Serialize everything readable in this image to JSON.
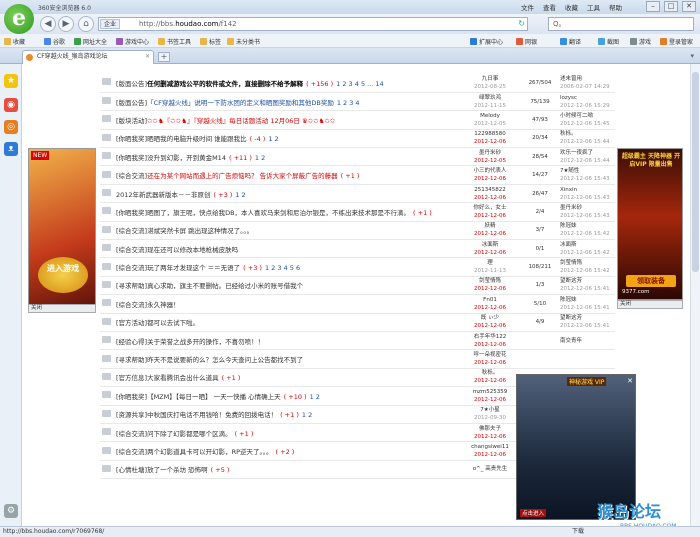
{
  "window": {
    "title": "360安全浏览器 6.0",
    "menu": [
      "文件",
      "查看",
      "收藏",
      "工具",
      "帮助"
    ]
  },
  "nav": {
    "mode": "企业",
    "url_prefix": "http://bbs.",
    "url_domain": "houdao.com",
    "url_path": "/f142",
    "search_placeholder": "Q。"
  },
  "favorites": [
    "收藏",
    "谷歌",
    "网址大全",
    "游戏中心",
    "书签工具",
    "标签",
    "未分类书"
  ],
  "toolbar_right": [
    "扩展中心",
    "网银",
    "翻译",
    "截图",
    "游戏",
    "登录管家"
  ],
  "tab": {
    "title": "CF穿越火线_猴岛游戏论坛"
  },
  "posts": [
    {
      "tag": "[版面公告]",
      "title": "任何删减游戏公平的软件或文件，直接删除不给予解释",
      "style": "bold",
      "pts": "( +156 )",
      "pages": "1 2 3 4 5 ... 14",
      "author": "九日事",
      "adate": "2012-08-25",
      "adred": false,
      "replies": "267/504",
      "last": "述未曾用",
      "ldate": "2006-02-07 14:29"
    },
    {
      "tag": "[版面公告]",
      "title": "「CF穿越火线」说明一下防水团的定义和晒图奖励和其他DB奖励",
      "style": "blue",
      "pts": "",
      "pages": "1 2 3 4",
      "author": "绿翠玖鸿",
      "adate": "2012-11-15",
      "adred": false,
      "replies": "75/139",
      "last": "lozysc",
      "ldate": "2012-12-06 15:29"
    },
    {
      "tag": "[版块活动]",
      "title": "✩✩♞『✩✩♞』『穿越火线』每日话题活动 12月06日 ♛✩✩♞✩✩",
      "style": "red",
      "pts": "",
      "pages": "",
      "author": "Melody",
      "adate": "2012-12-05",
      "adred": false,
      "replies": "47/93",
      "last": "小时候可二呦",
      "ldate": "2012-12-06 15:45"
    },
    {
      "tag": "[你晒我奖]",
      "title": "晒晒我的电脑升级时间   谁能跟我比",
      "style": "normal",
      "pts": "( -4 )",
      "pages": "1 2",
      "author": "122988580",
      "adate": "2012-12-06",
      "adred": true,
      "replies": "20/34",
      "last": "秋栎。",
      "ldate": "2012-12-06 15:44"
    },
    {
      "tag": "[你晒我奖]",
      "title": "没升到幻影，开到黄金M14",
      "style": "normal",
      "pts": "( +11 )",
      "pages": "1 2",
      "author": "墨丹米砂",
      "adate": "2012-12-05",
      "adred": true,
      "replies": "28/54",
      "last": "欢乐一夜疯了",
      "ldate": "2012-12-06 15:44"
    },
    {
      "tag": "[综合交流]",
      "title": "还在为某个网站而遇上的广告烦恼吗？ 告诉大家个屏蔽广告的藤器",
      "style": "red",
      "pts": "( +1 )",
      "pages": "",
      "author": "小三的代表人",
      "adate": "2012-12-06",
      "adred": true,
      "replies": "14/27",
      "last": "7★随性",
      "ldate": "2012-12-06 15:43"
    },
    {
      "tag": "2012年新武器新版本－－非原创",
      "title": "",
      "style": "normal",
      "pts": "( +3 )",
      "pages": "1 2",
      "author": "251345822",
      "adate": "2012-12-06",
      "adred": true,
      "replies": "26/47",
      "last": "Xinxin",
      "ldate": "2012-12-06 15:43"
    },
    {
      "tag": "[你晒我奖]",
      "title": "晒图了，旗王呢，快点给我DB，本人喜欢马来剑和尼泊尔银是，不练出来技术那是不行滴。",
      "style": "normal",
      "pts": "( +1 )",
      "pages": "",
      "author": "你好么，女士",
      "adate": "2012-12-06",
      "adred": true,
      "replies": "2/4",
      "last": "墨丹米砂",
      "ldate": "2012-12-06 15:43"
    },
    {
      "tag": "[综合交流]",
      "title": "湛斌突然卡屏  跳出现这种情况了。。。",
      "style": "normal",
      "pts": "",
      "pages": "",
      "author": "妖精",
      "adate": "2012-12-06",
      "adred": true,
      "replies": "3/7",
      "last": "陈冠妹",
      "ldate": "2012-12-06 15:42"
    },
    {
      "tag": "[综合交流]",
      "title": "现在还可以修改本地枪械皮肤吗",
      "style": "normal",
      "pts": "",
      "pages": "",
      "author": "冰面斯",
      "adate": "2012-12-06",
      "adred": true,
      "replies": "0/1",
      "last": "冰面斯",
      "ldate": "2012-12-06 15:42"
    },
    {
      "tag": "[综合交流]",
      "title": "玩了两年才发现这个 ＝＝无语了",
      "style": "normal",
      "pts": "( +3 )",
      "pages": "1 2 3 4 5 6",
      "author": "理",
      "adate": "2012-11-13",
      "adred": false,
      "replies": "108/211",
      "last": "剑莹情殇",
      "ldate": "2012-12-06 15:42"
    },
    {
      "tag": "[寻求帮助]",
      "title": "真心求助，旗主不要删帖。已经给过小米的账号借我个",
      "style": "normal",
      "pts": "",
      "pages": "",
      "author": "剑莹情殇",
      "adate": "2012-12-06",
      "adred": true,
      "replies": "1/3",
      "last": "望断这芳",
      "ldate": "2012-12-06 15:41"
    },
    {
      "tag": "[综合交流]",
      "title": "永久神器！",
      "style": "normal",
      "pts": "",
      "pages": "",
      "author": "Fn01",
      "adate": "2012-12-06",
      "adred": true,
      "replies": "5/10",
      "last": "陈冠妹",
      "ldate": "2012-12-06 15:41"
    },
    {
      "tag": "[官方活动]",
      "title": "都可以去试下啦。",
      "style": "normal",
      "pts": "",
      "pages": "",
      "author": "既 ぃ少",
      "adate": "2012-12-06",
      "adred": true,
      "replies": "4/9",
      "last": "望断这芳",
      "ldate": "2012-12-06 15:41"
    },
    {
      "tag": "[经验心得]",
      "title": "关于荣誉之战多开的操作，不喜勿喷！！",
      "style": "normal",
      "pts": "",
      "pages": "",
      "author": "右手年华122",
      "adate": "2012-12-06",
      "adred": true,
      "replies": "",
      "last": "南交青年",
      "ldate": ""
    },
    {
      "tag": "[寻求帮助]",
      "title": "昨天不是说要新的么？怎么今天查问上公告都找不到了",
      "style": "normal",
      "pts": "",
      "pages": "",
      "author": "呼一朵视密花",
      "adate": "2012-12-06",
      "adred": true,
      "replies": "",
      "last": "",
      "ldate": ""
    },
    {
      "tag": "[官方信息]",
      "title": "大家看腾讯会出什么道具",
      "style": "normal",
      "pts": "( +1 )",
      "pages": "",
      "author": "秋栎。",
      "adate": "2012-12-06",
      "adred": true,
      "replies": "",
      "last": "",
      "ldate": ""
    },
    {
      "tag": "[你晒我奖]",
      "title": "【MZM】【每日一晒】 一天一快播  心情确上天",
      "style": "normal",
      "pts": "( +10 )",
      "pages": "1 2",
      "author": "mzm525359",
      "adate": "2012-12-06",
      "adred": true,
      "replies": "",
      "last": "",
      "ldate": ""
    },
    {
      "tag": "[资源共享]",
      "title": "中秋国庆打电话不用钱哈！免费的回拨电话！",
      "style": "normal",
      "pts": "( +1 )",
      "pages": "1 2",
      "author": "7★小星",
      "adate": "2012-09-30",
      "adred": false,
      "replies": "",
      "last": "",
      "ldate": ""
    },
    {
      "tag": "[综合交流]",
      "title": "问下除了幻影都是哪个区滴。",
      "style": "normal",
      "pts": "( +1 )",
      "pages": "",
      "author": "佛那夫子",
      "adate": "2012-12-06",
      "adred": true,
      "replies": "",
      "last": "",
      "ldate": ""
    },
    {
      "tag": "[综合交流]",
      "title": "两个幻影道具卡可以开幻影，RP逆天了。。。",
      "style": "normal",
      "pts": "( +2 )",
      "pages": "",
      "author": "changsiwei11",
      "adate": "2012-12-06",
      "adred": true,
      "replies": "",
      "last": "",
      "ldate": ""
    },
    {
      "tag": "[心情杜塘]",
      "title": "放了一个杀坊  恐怖啊",
      "style": "normal",
      "pts": "( +5 )",
      "pages": "",
      "author": "o^_ 高贵先生",
      "adate": "",
      "adred": false,
      "replies": "",
      "last": "",
      "ldate": ""
    }
  ],
  "ads": {
    "left": {
      "badge": "NEW",
      "label": "进入游戏",
      "close": "关闭"
    },
    "right": {
      "top": "超级霸主 天降神器 开启VIP 限量出售",
      "button": "领取装备",
      "site": "9377.com",
      "close": "关闭"
    },
    "game": {
      "title": "神秘游戏 VIP",
      "label": "点击进入",
      "close": "✕"
    }
  },
  "watermark": {
    "brand": "猴岛论坛",
    "site": "BBS.HOUDAO.COM"
  },
  "status": {
    "url": "http://bbs.houdao.com/r7069768/",
    "download": "下载"
  }
}
